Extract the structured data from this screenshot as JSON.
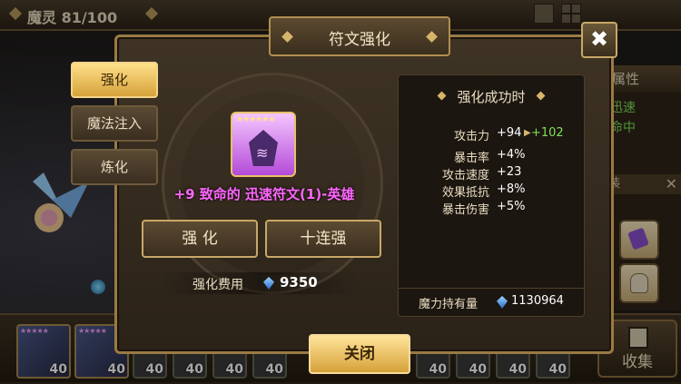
{
  "top_bar": {
    "monster_count": "魔灵 81/100"
  },
  "right_panel": {
    "attr_header": "属性",
    "attr_line_1": "迅速",
    "attr_line_2": "命中",
    "equip_tab": "装"
  },
  "collection_button": {
    "label": "收集"
  },
  "monster_roster": [
    {
      "level": "40"
    },
    {
      "level": "40"
    },
    {
      "level": "40"
    },
    {
      "level": "40"
    },
    {
      "level": "40"
    },
    {
      "level": "40"
    },
    {
      "level": "40"
    },
    {
      "level": "40"
    },
    {
      "level": "40"
    },
    {
      "level": "40"
    }
  ],
  "dialog": {
    "title": "符文强化",
    "close_glyph": "✖",
    "tabs": [
      {
        "label": "强化",
        "active": true
      },
      {
        "label": "魔法注入",
        "active": false
      },
      {
        "label": "炼化",
        "active": false
      }
    ],
    "rune": {
      "stars": "★★★★★★",
      "glyph": "≋",
      "name": "+9 致命的 迅速符文(1)-英雄"
    },
    "buttons": {
      "upgrade": "强 化",
      "upgrade_ten": "十连强"
    },
    "cost": {
      "label": "强化费用",
      "value": "9350"
    },
    "result": {
      "title": "强化成功时",
      "main_stat": {
        "label": "攻击力",
        "value": "+94",
        "arrow": "▶",
        "new_value": "+102"
      },
      "sub_stats": [
        {
          "label": "暴击率",
          "value": "+4%"
        },
        {
          "label": "攻击速度",
          "value": "+23"
        },
        {
          "label": "效果抵抗",
          "value": "+8%"
        },
        {
          "label": "暴击伤害",
          "value": "+5%"
        }
      ],
      "mana": {
        "label": "魔力持有量",
        "value": "1130964"
      }
    },
    "confirm": "关闭"
  },
  "colors": {
    "accent_gold": "#d6a23a",
    "rune_name": "#ff66ff",
    "stat_increase": "#7fe05a",
    "crystal_blue": "#2a6ac8"
  },
  "icons": [
    "grid-icon",
    "menu-icon",
    "close-icon",
    "crystal-icon",
    "rune-icon",
    "bag-icon",
    "collection-icon"
  ]
}
